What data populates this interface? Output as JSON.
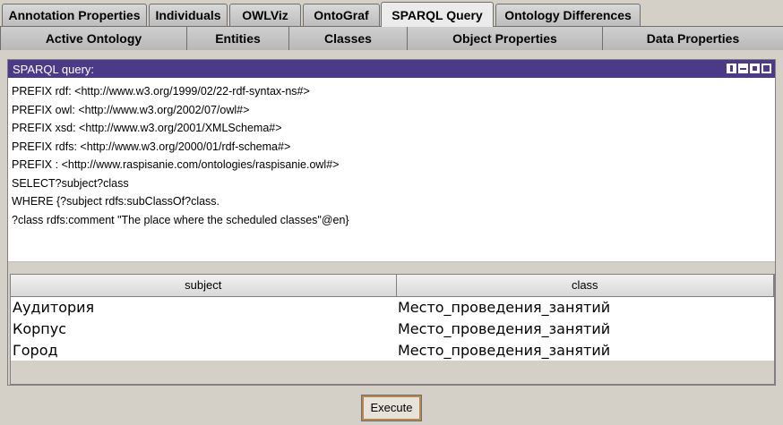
{
  "tabs_top": [
    {
      "label": "Annotation Properties",
      "active": false
    },
    {
      "label": "Individuals",
      "active": false
    },
    {
      "label": "OWLViz",
      "active": false
    },
    {
      "label": "OntoGraf",
      "active": false
    },
    {
      "label": "SPARQL Query",
      "active": true
    },
    {
      "label": "Ontology Differences",
      "active": false
    }
  ],
  "tabs_bottom": [
    {
      "label": "Active Ontology"
    },
    {
      "label": "Entities"
    },
    {
      "label": "Classes"
    },
    {
      "label": "Object Properties"
    },
    {
      "label": "Data Properties"
    }
  ],
  "panel": {
    "title": "SPARQL query:",
    "query_lines": [
      "PREFIX rdf: <http://www.w3.org/1999/02/22-rdf-syntax-ns#>",
      "PREFIX owl: <http://www.w3.org/2002/07/owl#>",
      "PREFIX xsd: <http://www.w3.org/2001/XMLSchema#>",
      "PREFIX rdfs: <http://www.w3.org/2000/01/rdf-schema#>",
      "PREFIX : <http://www.raspisanie.com/ontologies/raspisanie.owl#>",
      "SELECT?subject?class",
      "WHERE {?subject rdfs:subClassOf?class.",
      "?class rdfs:comment \"The place where the scheduled classes\"@en}"
    ]
  },
  "results": {
    "columns": [
      "subject",
      "class"
    ],
    "rows": [
      [
        "Аудитория",
        "Место_проведения_занятий"
      ],
      [
        "Корпус",
        "Место_проведения_занятий"
      ],
      [
        "Город",
        "Место_проведения_занятий"
      ]
    ]
  },
  "execute_label": "Execute"
}
